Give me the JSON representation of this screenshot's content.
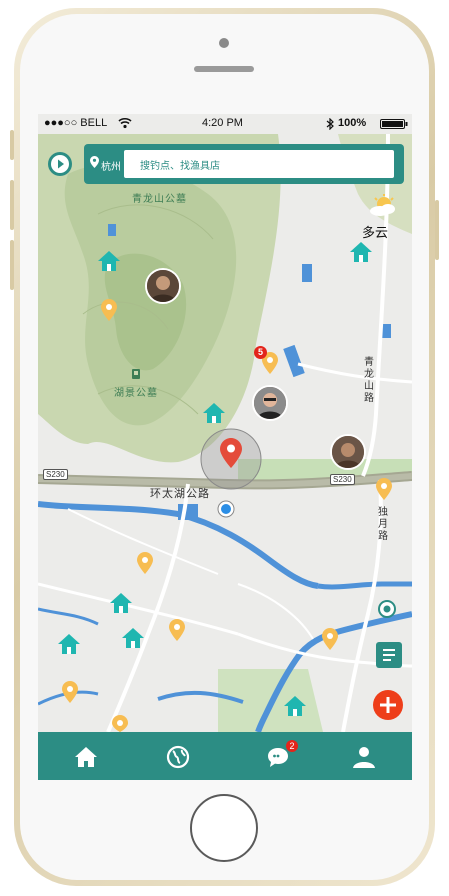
{
  "status_bar": {
    "carrier": "●●●○○ BELL",
    "time": "4:20 PM",
    "battery": "100%"
  },
  "search": {
    "city": "杭州",
    "placeholder": "搜钓点、找渔具店"
  },
  "weather": {
    "label": "多云",
    "icon": "partly-cloudy-icon"
  },
  "map_labels": {
    "park_north": "青龙山公墓",
    "park_lake": "湖景公墓",
    "road_qinglong": "青龙山路",
    "road_huantai": "环太湖公路",
    "road_duyue": "独月路",
    "shield_left": "S230",
    "shield_right": "S230"
  },
  "cluster": {
    "count": "5"
  },
  "tabbar": {
    "items": [
      {
        "icon": "home-icon"
      },
      {
        "icon": "globe-icon"
      },
      {
        "icon": "message-icon",
        "badge": "2"
      },
      {
        "icon": "profile-icon"
      }
    ]
  },
  "colors": {
    "brand": "#2c8d84",
    "pin": "#f7bd52",
    "house": "#1fb6b0",
    "accent": "#ee3e1a"
  }
}
